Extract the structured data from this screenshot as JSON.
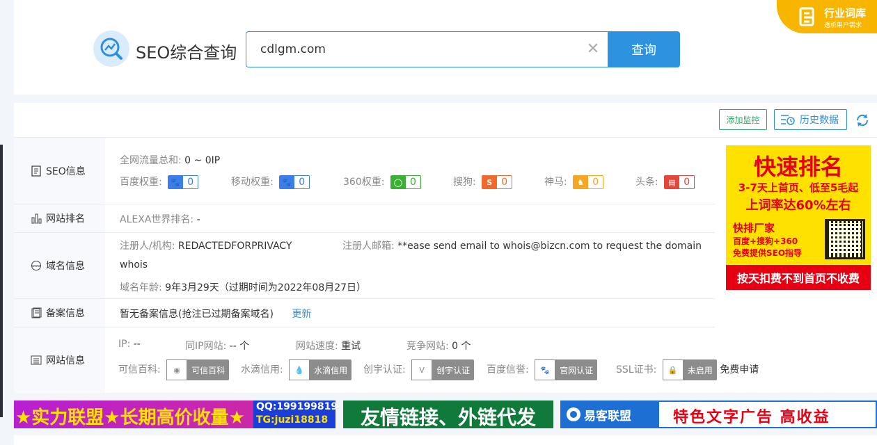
{
  "header": {
    "title": "SEO综合查询",
    "search_value": "cdlgm.com",
    "search_button": "查询",
    "clear_symbol": "✕",
    "corner_title": "行业词库",
    "corner_sub": "透析用户需求"
  },
  "toolbar": {
    "monitor": "添加监控",
    "history": "历史数据"
  },
  "seo": {
    "label": "SEO信息",
    "traffic_label": "全网流量总和:",
    "traffic_value": "0 ~ 0IP",
    "weights": [
      {
        "label": "百度权重:",
        "value": "0",
        "color": "#3b7fe6",
        "icon": "baidu-paw-icon"
      },
      {
        "label": "移动权重:",
        "value": "0",
        "color": "#3b7fe6",
        "icon": "baidu-paw-icon"
      },
      {
        "label": "360权重:",
        "value": "0",
        "color": "#3cb034",
        "icon": "360-icon"
      },
      {
        "label": "搜狗:",
        "value": "0",
        "color": "#ef6a2c",
        "icon": "sogou-icon"
      },
      {
        "label": "神马:",
        "value": "0",
        "color": "#f5a623",
        "icon": "shenma-icon"
      },
      {
        "label": "头条:",
        "value": "0",
        "color": "#e2473e",
        "icon": "toutiao-icon"
      }
    ]
  },
  "rank": {
    "label": "网站排名",
    "alexa_label": "ALEXA世界排名:",
    "alexa_value": "-"
  },
  "domain": {
    "label": "域名信息",
    "registrant_label": "注册人/机构:",
    "registrant_value": "REDACTEDFORPRIVACY",
    "email_label": "注册人邮箱:",
    "email_value": "**ease send email to whois@bizcn.com to request the domain",
    "email_wrap": "whois",
    "age_label": "域名年龄:",
    "age_value": "9年3月29天（过期时间为2022年08月27日）"
  },
  "icp": {
    "label": "备案信息",
    "value": "暂无备案信息(抢注已过期备案域名)",
    "update": "更新"
  },
  "site": {
    "label": "网站信息",
    "ip_label": "IP:",
    "ip_value": "--",
    "sameip_label": "同IP网站:",
    "sameip_value": "-- 个",
    "speed_label": "网站速度:",
    "speed_value": "重试",
    "compete_label": "竞争网站:",
    "compete_value": "0 个",
    "certs": [
      {
        "label": "可信百科:",
        "badge": "可信百科",
        "icon": "trusted-icon"
      },
      {
        "label": "水滴信用:",
        "badge": "水滴信用",
        "icon": "water-drop-icon"
      },
      {
        "label": "创宇认证:",
        "badge": "创宇认证",
        "icon": "chuangyu-icon"
      },
      {
        "label": "百度信誉:",
        "badge": "官网认证",
        "icon": "baidu-paw-icon"
      },
      {
        "label": "SSL证书:",
        "badge": "未启用",
        "icon": "ssl-icon"
      }
    ],
    "ssl_free": "免费申请"
  },
  "ad_right": {
    "line1": "快速排名",
    "line2": "3-7天上首页、低至5毛起",
    "line3": "上词率达60%左右",
    "line4": "快排厂家",
    "line5": "百度+搜狗+360",
    "line6": "免费提供SEO指导",
    "line7": "按天扣费不到首页不收费"
  },
  "ads_bottom": {
    "ad1_text": "★实力联盟★长期高价收量★",
    "ad1_qq": "QQ:199199819",
    "ad1_tg": "TG:juzi18818",
    "ad2_text": "友情链接、外链代发",
    "ad3_brand": "易客联盟",
    "ad3_text": "特色文字广告 高收益"
  }
}
